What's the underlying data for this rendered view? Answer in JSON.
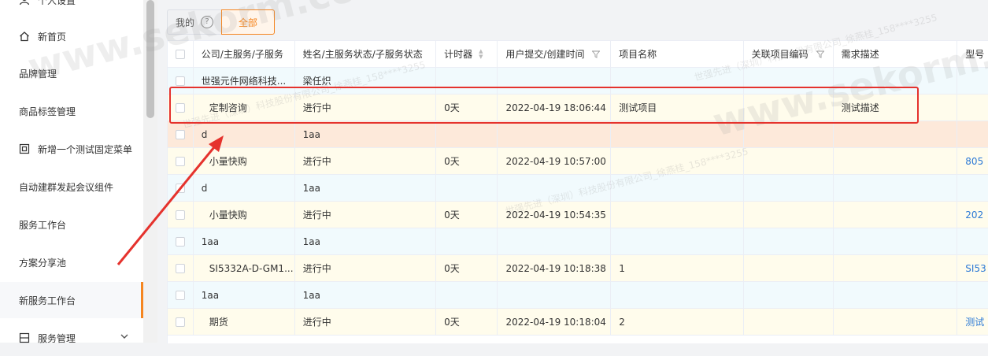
{
  "sidebar": {
    "items": [
      {
        "label": "个人设置",
        "icon": "user-icon"
      },
      {
        "label": "新首页",
        "icon": "home-icon"
      },
      {
        "label": "品牌管理"
      },
      {
        "label": "商品标签管理"
      },
      {
        "label": "新增一个测试固定菜单",
        "icon": "box-icon"
      },
      {
        "label": "自动建群发起会议组件"
      },
      {
        "label": "服务工作台"
      },
      {
        "label": "方案分享池"
      },
      {
        "label": "新服务工作台",
        "active": true
      },
      {
        "label": "服务管理",
        "icon": "grid-icon"
      }
    ]
  },
  "tabs": {
    "mine": "我的",
    "all": "全部"
  },
  "table": {
    "headers": [
      "公司/主服务/子服务",
      "姓名/主服务状态/子服务状态",
      "计时器",
      "用户提交/创建时间",
      "项目名称",
      "关联项目编码",
      "需求描述",
      "型号"
    ],
    "rows": [
      {
        "c1": "世强元件网络科技...",
        "c2": "梁任炽",
        "c3": "",
        "c4": "",
        "c5": "",
        "c6": "",
        "c7": "",
        "c8": ""
      },
      {
        "c1": "定制咨询",
        "c2": "进行中",
        "c3": "0天",
        "c4": "2022-04-19 18:06:44",
        "c5": "测试项目",
        "c6": "",
        "c7": "测试描述",
        "c8": ""
      },
      {
        "c1": "d",
        "c2": "1aa",
        "c3": "",
        "c4": "",
        "c5": "",
        "c6": "",
        "c7": "",
        "c8": ""
      },
      {
        "c1": "小量快购",
        "c2": "进行中",
        "c3": "0天",
        "c4": "2022-04-19 10:57:00",
        "c5": "",
        "c6": "",
        "c7": "",
        "c8": "805"
      },
      {
        "c1": "d",
        "c2": "1aa",
        "c3": "",
        "c4": "",
        "c5": "",
        "c6": "",
        "c7": "",
        "c8": ""
      },
      {
        "c1": "小量快购",
        "c2": "进行中",
        "c3": "0天",
        "c4": "2022-04-19 10:54:35",
        "c5": "",
        "c6": "",
        "c7": "",
        "c8": "202"
      },
      {
        "c1": "1aa",
        "c2": "1aa",
        "c3": "",
        "c4": "",
        "c5": "",
        "c6": "",
        "c7": "",
        "c8": ""
      },
      {
        "c1": "SI5332A-D-GM1...",
        "c2": "进行中",
        "c3": "0天",
        "c4": "2022-04-19 10:18:38",
        "c5": "1",
        "c6": "",
        "c7": "",
        "c8": "SI53"
      },
      {
        "c1": "1aa",
        "c2": "1aa",
        "c3": "",
        "c4": "",
        "c5": "",
        "c6": "",
        "c7": "",
        "c8": ""
      },
      {
        "c1": "期货",
        "c2": "进行中",
        "c3": "0天",
        "c4": "2022-04-19 10:18:04",
        "c5": "2",
        "c6": "",
        "c7": "",
        "c8": "测试"
      }
    ]
  },
  "watermark": {
    "large": "www.sekorm.com",
    "small": "世强先进（深圳）科技股份有限公司_徐燕桂_158****3255"
  },
  "colors": {
    "accent": "#f5851f",
    "highlight": "#e5322d",
    "link": "#2d7ad6"
  }
}
